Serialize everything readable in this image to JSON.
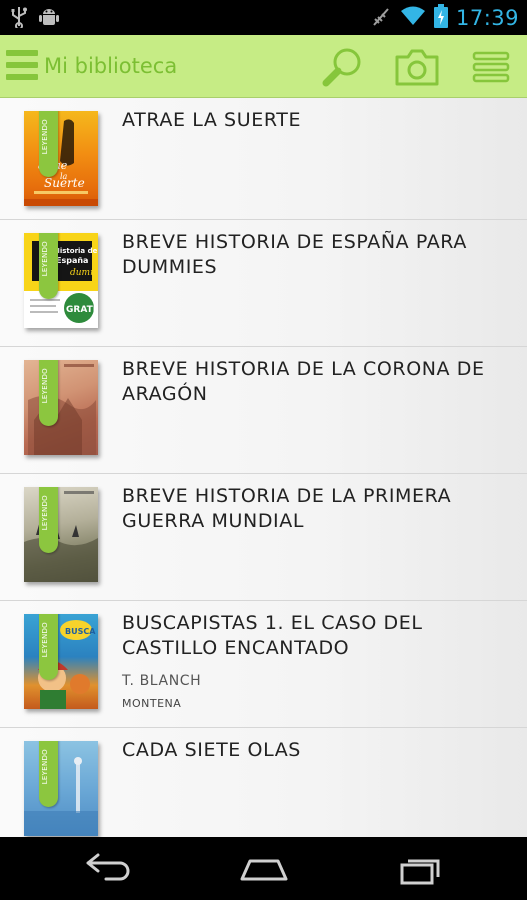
{
  "status_bar": {
    "time": "17:39",
    "icons": [
      "usb-icon",
      "android-debug-icon",
      "signal-off-icon",
      "wifi-icon",
      "battery-charging-icon"
    ]
  },
  "action_bar": {
    "title": "Mi biblioteca",
    "icons": [
      "menu-icon",
      "search-icon",
      "camera-icon",
      "overflow-icon"
    ],
    "accent_color": "#8cc63f",
    "bar_color": "#c6ec85"
  },
  "books": [
    {
      "title": "ATRAE LA SUERTE",
      "author": "",
      "publisher": "",
      "cover": {
        "ribbon": "LEYENDO",
        "lines": [
          "atrae",
          "la",
          "Suerte"
        ]
      }
    },
    {
      "title": "BREVE HISTORIA DE ESPAÑA PARA DUMMIES",
      "author": "",
      "publisher": "",
      "cover": {
        "ribbon": "LEYENDO",
        "lines": [
          "Historia de",
          "España",
          "GRATIS"
        ]
      }
    },
    {
      "title": "BREVE HISTORIA DE LA CORONA DE ARAGÓN",
      "author": "",
      "publisher": "",
      "cover": {
        "ribbon": "LEYENDO"
      }
    },
    {
      "title": "BREVE HISTORIA DE LA PRIMERA GUERRA MUNDIAL",
      "author": "",
      "publisher": "",
      "cover": {
        "ribbon": "LEYENDO"
      }
    },
    {
      "title": "BUSCAPISTAS 1. EL CASO DEL CASTILLO ENCANTADO",
      "author": "T. BLANCH",
      "publisher": "MONTENA",
      "cover": {
        "ribbon": "LEYENDO"
      }
    },
    {
      "title": "CADA SIETE OLAS",
      "author": "",
      "publisher": "",
      "cover": {
        "ribbon": "LEYENDO"
      }
    }
  ],
  "nav_bar": {
    "buttons": [
      "back-icon",
      "home-icon",
      "recent-apps-icon"
    ]
  }
}
